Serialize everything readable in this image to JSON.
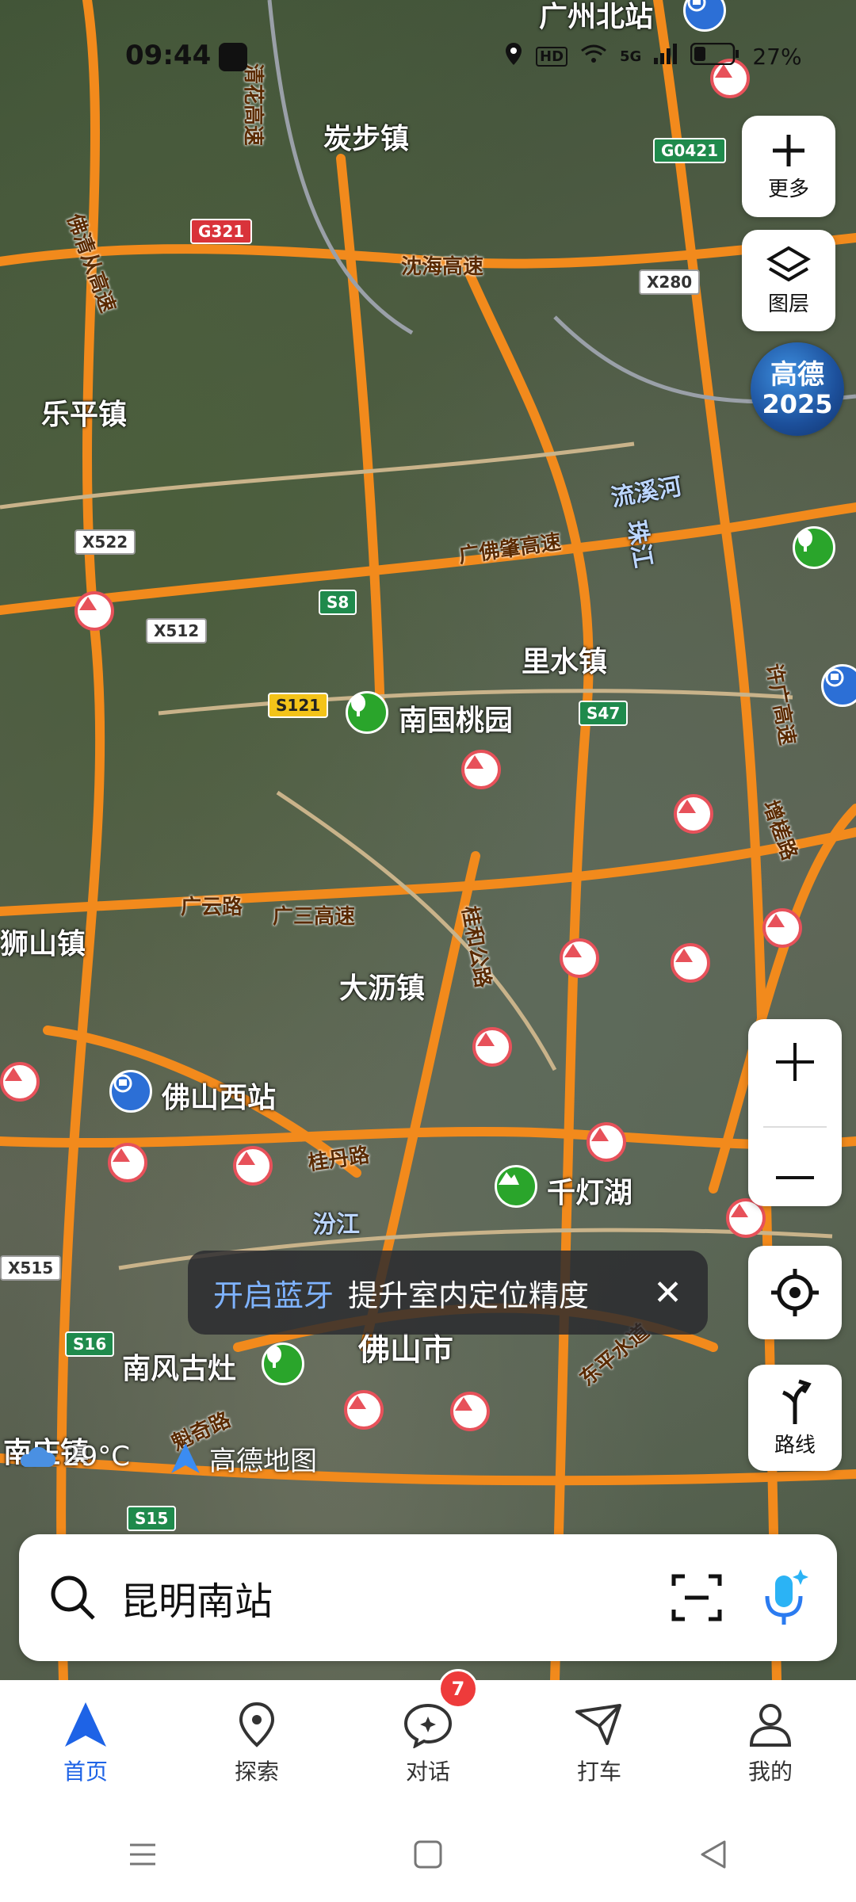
{
  "status_bar": {
    "time": "09:44",
    "battery": "27%",
    "network": "5G",
    "hd": "HD"
  },
  "map": {
    "place_labels": [
      {
        "id": "tanbu",
        "text": "炭步镇"
      },
      {
        "id": "leping",
        "text": "乐平镇"
      },
      {
        "id": "lishui",
        "text": "里水镇"
      },
      {
        "id": "nanguo",
        "text": "南国桃园"
      },
      {
        "id": "shishan",
        "text": "狮山镇"
      },
      {
        "id": "dali",
        "text": "大沥镇"
      },
      {
        "id": "foshanxi",
        "text": "佛山西站"
      },
      {
        "id": "qiandeng",
        "text": "千灯湖"
      },
      {
        "id": "nanfeng",
        "text": "南风古灶"
      },
      {
        "id": "foshan",
        "text": "佛山市"
      },
      {
        "id": "guangzhoubei",
        "text": "广州北站"
      },
      {
        "id": "liuxi",
        "text": "流溪河"
      },
      {
        "id": "zhujiang",
        "text": "珠江"
      },
      {
        "id": "fenjiang",
        "text": "汾江"
      },
      {
        "id": "nanzhuang",
        "text": "南庄镇"
      }
    ],
    "road_labels": [
      {
        "id": "qinghua",
        "text": "清花高速"
      },
      {
        "id": "foqing",
        "text": "佛清从高速"
      },
      {
        "id": "shenhai",
        "text": "沈海高速"
      },
      {
        "id": "guangfozhao",
        "text": "广佛肇高速"
      },
      {
        "id": "guangyun",
        "text": "广云路"
      },
      {
        "id": "guangsan",
        "text": "广三高速"
      },
      {
        "id": "guihe",
        "text": "桂和公路"
      },
      {
        "id": "guidan",
        "text": "桂丹路"
      },
      {
        "id": "xuguang",
        "text": "许广高速"
      },
      {
        "id": "zengcha",
        "text": "增槎路"
      },
      {
        "id": "kuiqi",
        "text": "魁奇路"
      },
      {
        "id": "dongping",
        "text": "东平水道"
      }
    ],
    "shields": [
      {
        "id": "g0421",
        "text": "G0421",
        "color": "green"
      },
      {
        "id": "g321",
        "text": "G321",
        "color": "red"
      },
      {
        "id": "x280",
        "text": "X280",
        "color": "white"
      },
      {
        "id": "x522",
        "text": "X522",
        "color": "white"
      },
      {
        "id": "x512",
        "text": "X512",
        "color": "white"
      },
      {
        "id": "s8",
        "text": "S8",
        "color": "green"
      },
      {
        "id": "s121",
        "text": "S121",
        "color": "yellow"
      },
      {
        "id": "s47",
        "text": "S47",
        "color": "green"
      },
      {
        "id": "x515",
        "text": "X515",
        "color": "white"
      },
      {
        "id": "s16",
        "text": "S16",
        "color": "green"
      },
      {
        "id": "s15",
        "text": "S15",
        "color": "green"
      }
    ]
  },
  "controls": {
    "more_label": "更多",
    "layers_label": "图层",
    "badge_line1": "高德",
    "badge_line2": "2025",
    "route_label": "路线"
  },
  "toast": {
    "link": "开启蓝牙",
    "message": "提升室内定位精度"
  },
  "weather": {
    "temp": "29°C"
  },
  "brand": {
    "name": "高德地图"
  },
  "search": {
    "text": "昆明南站"
  },
  "tabs": [
    {
      "label": "首页",
      "icon": "nav-arrow-icon",
      "active": true
    },
    {
      "label": "探索",
      "icon": "location-pin-icon"
    },
    {
      "label": "对话",
      "icon": "chat-icon",
      "badge": "7"
    },
    {
      "label": "打车",
      "icon": "taxi-icon"
    },
    {
      "label": "我的",
      "icon": "profile-icon"
    }
  ],
  "colors": {
    "accent": "#1e63e6",
    "road": "#f28a1c",
    "badge": "#ee3b3b"
  }
}
